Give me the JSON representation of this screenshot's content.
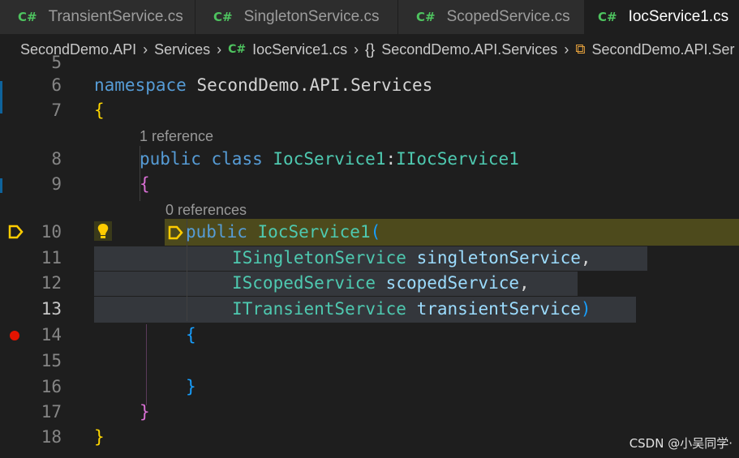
{
  "tabs": [
    {
      "lang": "C#",
      "label": "TransientService.cs"
    },
    {
      "lang": "C#",
      "label": "SingletonService.cs"
    },
    {
      "lang": "C#",
      "label": "ScopedService.cs"
    },
    {
      "lang": "C#",
      "label": "IocService1.cs",
      "close": "✕"
    }
  ],
  "breadcrumb": {
    "project": "SecondDemo.API",
    "folder": "Services",
    "file_lang": "C#",
    "file": "IocService1.cs",
    "ns_icon": "{}",
    "namespace": "SecondDemo.API.Services",
    "class_icon": "class-icon",
    "class_path": "SecondDemo.API.Ser"
  },
  "code": {
    "lines": {
      "partial": "5",
      "l6": "6",
      "l7": "7",
      "l8": "8",
      "l9": "9",
      "l10": "10",
      "l11": "11",
      "l12": "12",
      "l13": "13",
      "l14": "14",
      "l15": "15",
      "l16": "16",
      "l17": "17",
      "l18": "18"
    },
    "ns_keyword": "namespace",
    "ns_name": "SecondDemo.API.Services",
    "open_brace": "{",
    "close_brace": "}",
    "ref_class": "1 reference",
    "class_public": "public",
    "class_kw": "class",
    "class_name": "IocService1",
    "colon": ":",
    "interface_name": "IIocService1",
    "ref_ctor": "0 references",
    "ctor_public": "public",
    "ctor_name": "IocService1",
    "paren_open": "(",
    "paren_close": ")",
    "comma": ",",
    "params": [
      {
        "type": "ISingletonService",
        "name": "singletonService"
      },
      {
        "type": "IScopedService",
        "name": "scopedService"
      },
      {
        "type": "ITransientService",
        "name": "transientService"
      }
    ]
  },
  "watermark": "CSDN @小吴同学·"
}
